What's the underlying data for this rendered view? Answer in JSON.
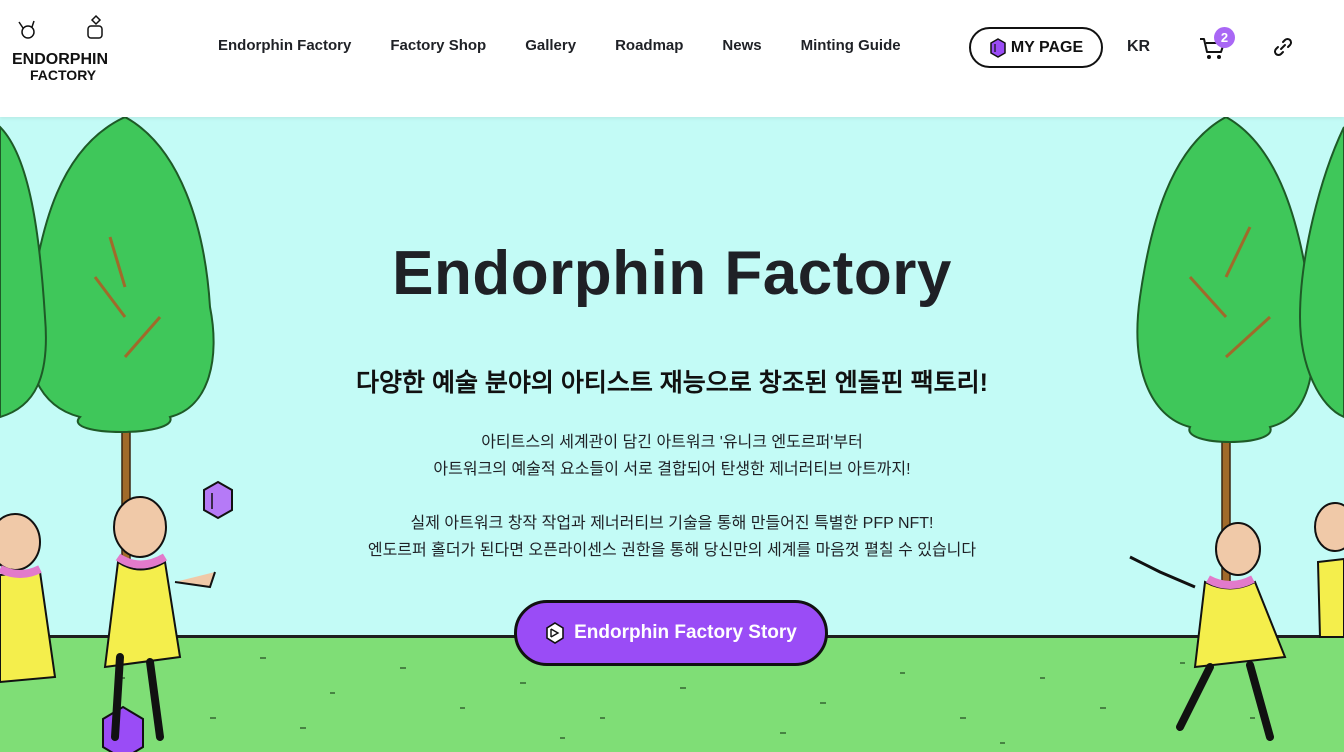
{
  "header": {
    "logo": {
      "icon": "endorphin-factory-logo",
      "line1": "ENDORPHIN",
      "line2": "FACTORY"
    },
    "nav": [
      {
        "label": "Endorphin Factory"
      },
      {
        "label": "Factory Shop"
      },
      {
        "label": "Gallery"
      },
      {
        "label": "Roadmap"
      },
      {
        "label": "News"
      },
      {
        "label": "Minting Guide"
      }
    ],
    "my_page_label": "MY PAGE",
    "language": "KR",
    "cart_count": "2",
    "link_icon": "link-icon"
  },
  "hero": {
    "title": "Endorphin Factory",
    "subtitle": "다양한 예술 분야의 아티스트 재능으로 창조된 엔돌핀 팩토리!",
    "desc_lines": [
      "아티트스의 세계관이 담긴 아트워크 '유니크 엔도르퍼'부터",
      "아트워크의 예술적 요소들이 서로 결합되어 탄생한 제너러티브 아트까지!",
      "실제 아트워크 창작 작업과 제너러티브 기술을 통해 만들어진 특별한 PFP NFT!",
      "엔도르퍼 홀더가 된다면 오픈라이센스 권한을 통해 당신만의 세계를 마음껏 펼칠 수 있습니다"
    ],
    "story_button_label": "Endorphin Factory Story"
  },
  "colors": {
    "hero_bg": "#c3fbf6",
    "ground": "#7fde76",
    "accent_purple": "#9a4cf6",
    "badge_purple": "#a967f5",
    "tree_green": "#3fc75a",
    "character_yellow": "#f4ee4c"
  }
}
